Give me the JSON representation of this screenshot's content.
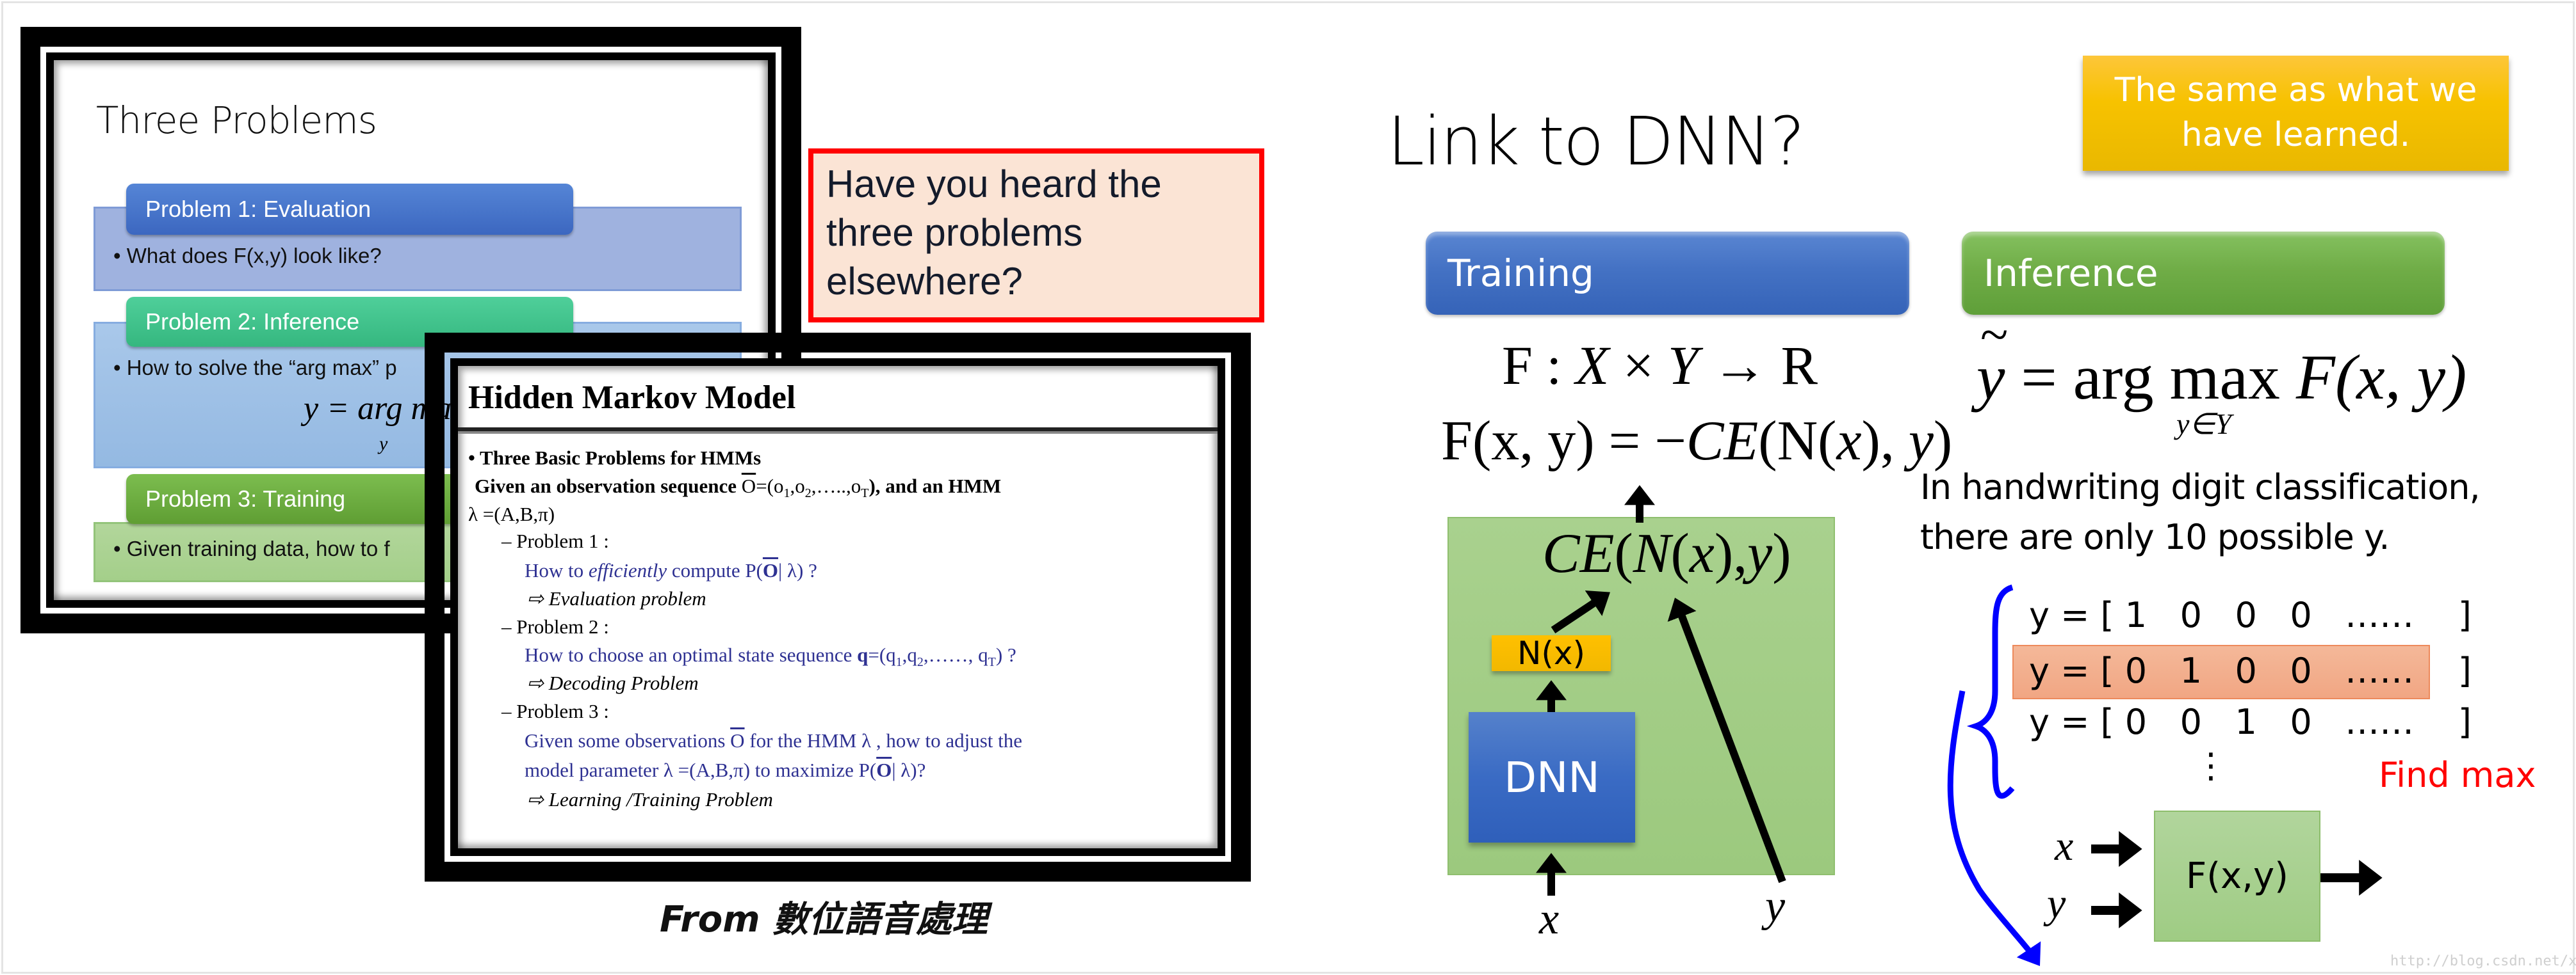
{
  "left_slide": {
    "title": "Three Problems",
    "problems": [
      {
        "header": "Problem 1: Evaluation",
        "bullet": "• What does F(x,y) look like?"
      },
      {
        "header": "Problem 2: Inference",
        "bullet": "• How to solve the “arg max” p",
        "formula_main": "y = arg max",
        "formula_sub": "y"
      },
      {
        "header": "Problem 3: Training",
        "bullet": "• Given training data, how to f"
      }
    ],
    "colors": {
      "p1_head": "#4472c4",
      "p1_bg": "#9fb2df",
      "p2_head": "#3fbf8a",
      "p2_bg": "#9dc3e6",
      "p3_head": "#6bab3f",
      "p3_bg": "#a9d18e"
    }
  },
  "hmm_slide": {
    "title": "Hidden Markov Model",
    "lines": [
      "• Three Basic Problems for HMMs",
      "Given an observation sequence O̅=(o₁,o₂,…..,o_T), and an HMM",
      "λ =(A,B,π)",
      "– Problem 1 :",
      "How to efficiently compute P(O̅| λ) ?",
      "⇨ Evaluation problem",
      "– Problem 2 :",
      "How to choose an optimal state sequence q=(q₁,q₂,……, q_T) ?",
      "⇨ Decoding Problem",
      "– Problem 3 :",
      "Given some observations O̅ for the HMM λ , how to adjust the",
      "model parameter λ =(A,B,π) to maximize P(O̅| λ)?",
      "⇨ Learning /Training Problem"
    ],
    "rich": {
      "l1": "Given an observation sequence ",
      "obs": "O",
      "seq": "=(o",
      "s1": "1",
      "c1": ",o",
      "s2": "2",
      "c2": ",…..,o",
      "sT": "T",
      "l1end": "), and an HMM",
      "p1a": "How to ",
      "p1b": "efficiently",
      "p1c": " compute P(",
      "p1d": "| λ) ?",
      "p2a": "How to choose an optimal state sequence ",
      "p2q": "q",
      "p2b": "=(q",
      "p2c": ",q",
      "p2d": ",……, q",
      "p2e": ") ?",
      "p3a": "Given some observations ",
      "p3b": " for the HMM λ , how to adjust the",
      "p3c": "model parameter λ =(A,B,π) to maximize P(",
      "p3d": "| λ)?"
    },
    "text_color": "#2e3192"
  },
  "question_box": {
    "lines": [
      "Have you heard the",
      "three problems",
      "elsewhere?"
    ],
    "border_color": "#ff0000",
    "bg_color": "#fbe4d5"
  },
  "caption": {
    "from": "From ",
    "source": "數位語音處理"
  },
  "right_slide": {
    "title": "Link to DNN?",
    "note": [
      "The same as what we",
      "have learned."
    ],
    "training": {
      "header": "Training",
      "formula1": {
        "F": "F",
        "colon": " : ",
        "X": "X",
        "times": " × ",
        "Y": "Y",
        "arrow": " → ",
        "R": "R"
      },
      "formula2": {
        "lhs": "F(x, y)",
        "eq": " = −",
        "ce": "CE",
        "rest": "(N(",
        "x": "x",
        "close": "), ",
        "y": "y",
        "end": ")"
      },
      "inner_formula": {
        "ce": "CE",
        "open": "(",
        "n": "N",
        "open2": "(",
        "x": "x",
        "close": "),",
        "y": "y",
        "end": ")"
      },
      "nx_label": "N(x)",
      "dnn_label": "DNN",
      "x_input": "x",
      "y_input": "y"
    },
    "inference": {
      "header": "Inference",
      "formula": {
        "ytilde": "y",
        "tilde": "~",
        "eq": " = arg max ",
        "F": "F",
        "args": "(x, y)",
        "sub": "y∈Y"
      },
      "text": [
        "In handwriting digit classification,",
        "there are only 10 possible y."
      ],
      "vectors": [
        "y = [ 1   0   0   0   ……    ]",
        "y = [ 0   1   0   0   ……    ]",
        "y = [ 0   0   1   0   ……    ]"
      ],
      "vdots": "⋮",
      "highlighted_index": 1,
      "find_max": "Find max",
      "x_input": "x",
      "y_input": "y",
      "fxy_label": "F(x,y)"
    },
    "colors": {
      "training_head": "#4472c4",
      "inference_head": "#70ad47",
      "note": "#ffc000",
      "find_max": "#ff0000",
      "brace": "#0000ff"
    }
  },
  "watermark": "http://blog.csdn.net/xzy_thu"
}
